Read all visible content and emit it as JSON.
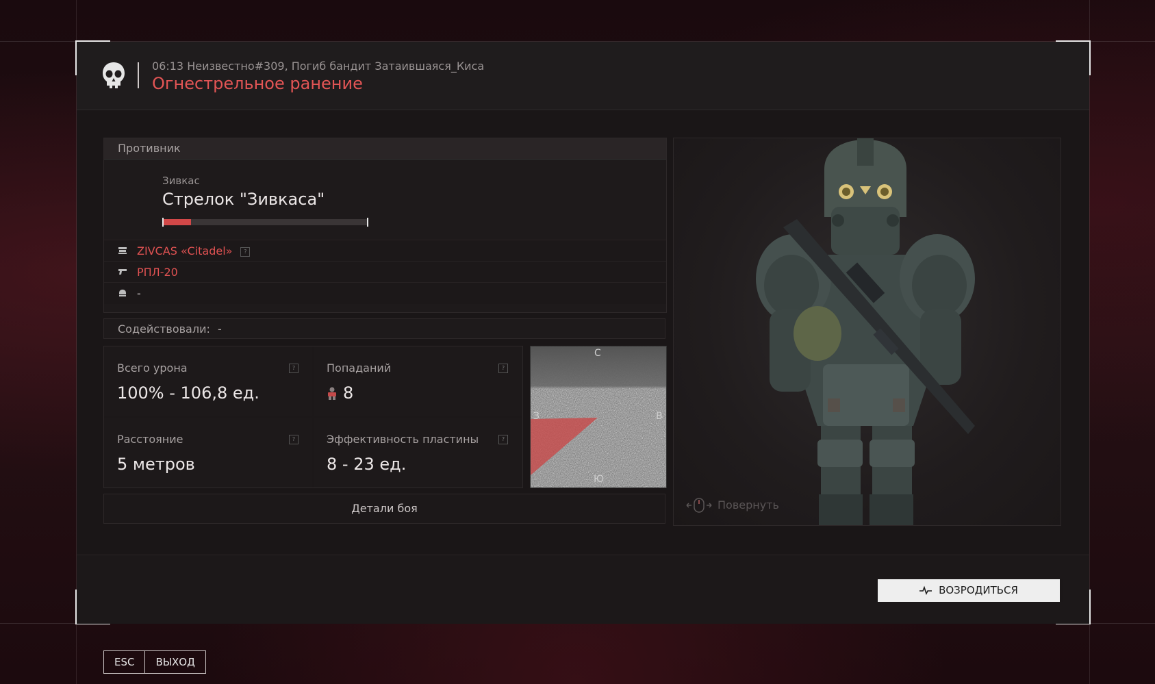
{
  "header": {
    "subtitle": "06:13 Неизвестно#309, Погиб бандит Затаившаяся_Киса",
    "title": "Огнестрельное ранение",
    "title_color": "#e35555"
  },
  "enemy": {
    "section_label": "Противник",
    "faction": "Зивкас",
    "name": "Стрелок \"Зивкаса\"",
    "health_fraction": 0.14,
    "health_color": "#d24848",
    "equipment": [
      {
        "icon": "armor-icon",
        "label": "ZIVCAS «Citadel»",
        "help": "?"
      },
      {
        "icon": "gun-icon",
        "label": "РПЛ-20"
      },
      {
        "icon": "helmet-icon",
        "label": "-"
      }
    ]
  },
  "assist": {
    "label": "Содействовали:",
    "value": "-"
  },
  "stats": [
    {
      "label": "Всего урона",
      "value": "100% - 106,8 ед.",
      "help": "?"
    },
    {
      "label": "Попаданий",
      "value": "8",
      "help": "?",
      "icon": "body-hit-icon"
    },
    {
      "label": "Расстояние",
      "value": "5 метров",
      "help": "?"
    },
    {
      "label": "Эффективность пластины",
      "value": "8 - 23 ед.",
      "help": "?"
    }
  ],
  "minimap": {
    "north": "С",
    "south": "Ю",
    "west": "З",
    "east": "В"
  },
  "details_button": "Детали боя",
  "viewer": {
    "rotate_hint": "Повернуть"
  },
  "footer": {
    "respawn_button": "ВОЗРОДИТЬСЯ"
  },
  "exit": {
    "key": "ESC",
    "label": "ВЫХОД"
  }
}
